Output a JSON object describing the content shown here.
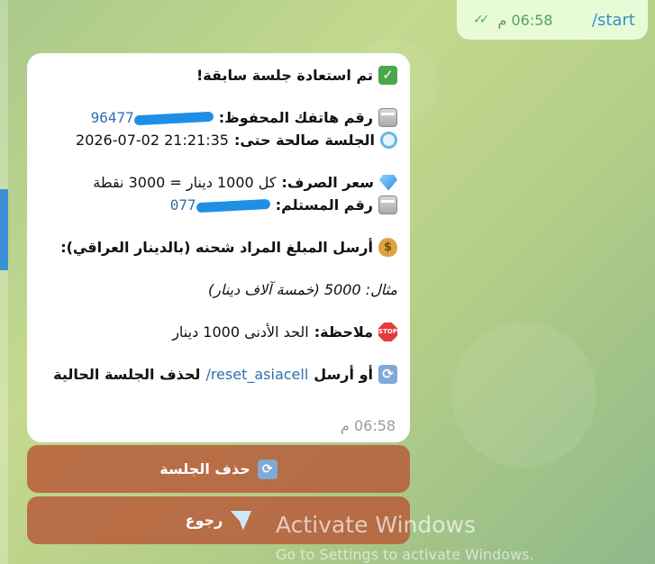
{
  "outgoing": {
    "text": "/start",
    "time": "06:58 م",
    "ticks": "✓✓"
  },
  "message": {
    "line1": "تم استعادة جلسة سابقة!",
    "line2_label": "رقم هاتفك المحفوظ:",
    "line2_value": "96477",
    "line3_label": "الجلسة صالحة حتى:",
    "line3_value": "2026-07-02 21:21:35",
    "line4_label": "سعر الصرف:",
    "line4_value": "كل 1000 دينار = 3000 نقطة",
    "line5_label": "رقم المستلم:",
    "line5_value": "077",
    "line6": "أرسل المبلغ المراد شحنه (بالدينار العراقي):",
    "line7": "مثال: 5000 (خمسة آلاف دينار)",
    "line8_label": "ملاحظة:",
    "line8_value": "الحد الأدنى 1000 دينار",
    "line9_prefix": "أو أرسل",
    "line9_link": "/reset_asiacell",
    "line9_suffix": "لحذف الجلسة الحالية",
    "time": "06:58 م",
    "icons": [
      "check-icon",
      "sim-card-icon",
      "magnifier-icon",
      "gem-icon",
      "sim-card-icon",
      "money-bag-icon",
      "stop-sign-icon",
      "refresh-icon"
    ]
  },
  "keyboard": {
    "delete_session": "حذف الجلسة",
    "back": "رجوع"
  },
  "watermark": {
    "title": "Activate Windows",
    "subtitle": "Go to Settings to activate Windows."
  },
  "colors": {
    "link": "#2f6fae",
    "button": "#b75c3a",
    "accent": "#3d8fd6"
  }
}
